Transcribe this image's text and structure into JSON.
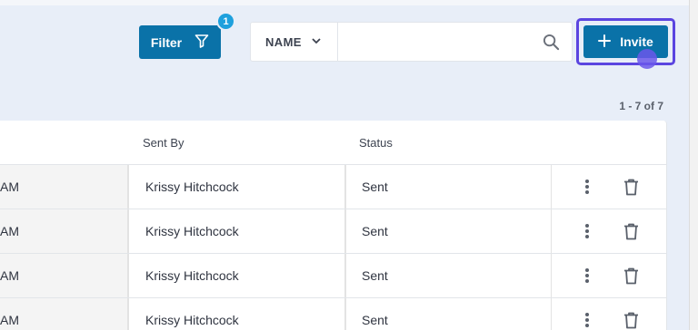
{
  "toolbar": {
    "filter_label": "Filter",
    "filter_badge": "1",
    "search_field_label": "NAME",
    "search_value": "",
    "search_placeholder": "",
    "invite_label": "Invite"
  },
  "pagination": "1 - 7 of 7",
  "table": {
    "headers": {
      "sent_by": "Sent By",
      "status": "Status"
    },
    "rows": [
      {
        "date_fragment": "AM",
        "sent_by": "Krissy Hitchcock",
        "status": "Sent"
      },
      {
        "date_fragment": "AM",
        "sent_by": "Krissy Hitchcock",
        "status": "Sent"
      },
      {
        "date_fragment": "AM",
        "sent_by": "Krissy Hitchcock",
        "status": "Sent"
      },
      {
        "date_fragment": "AM",
        "sent_by": "Krissy Hitchcock",
        "status": "Sent"
      }
    ]
  },
  "icons": {
    "filter": "filter-funnel-icon",
    "chevron": "chevron-down-icon",
    "search": "search-icon",
    "invite": "plus-icon",
    "more": "more-vertical-icon",
    "delete": "trash-icon"
  },
  "colors": {
    "primary": "#0a72a8",
    "badge": "#1ea0dd",
    "focus_ring": "#5b45e0",
    "background": "#e8eef8"
  }
}
